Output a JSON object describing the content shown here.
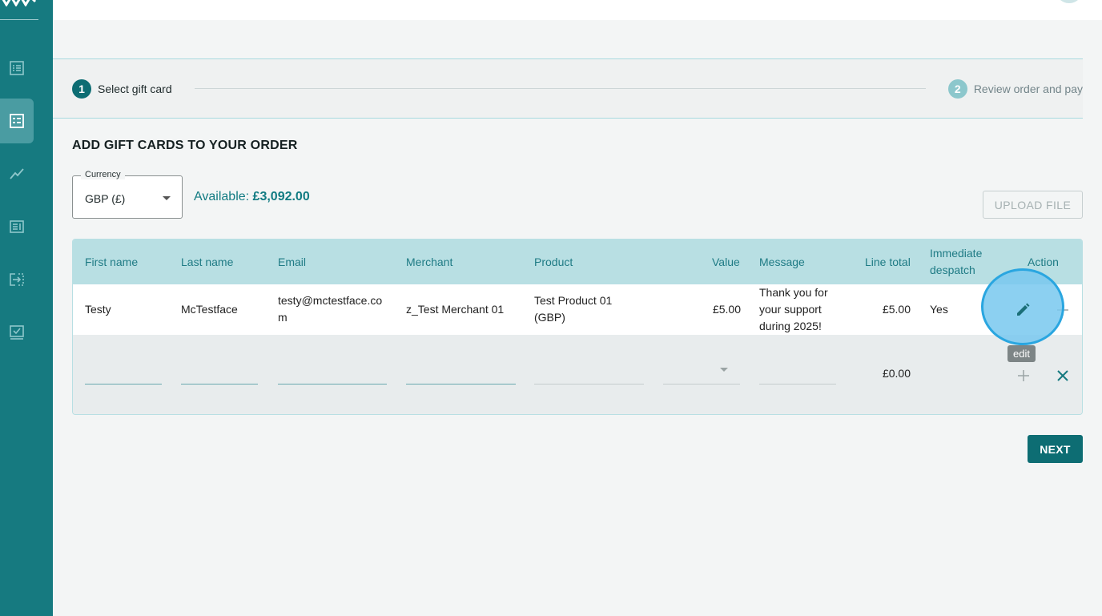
{
  "stepper": {
    "steps": [
      {
        "number": "1",
        "label": "Select gift card"
      },
      {
        "number": "2",
        "label": "Review order and pay"
      }
    ]
  },
  "page": {
    "heading": "ADD GIFT CARDS TO YOUR ORDER"
  },
  "currency": {
    "label": "Currency",
    "value": "GBP (£)"
  },
  "available": {
    "label": "Available:",
    "amount": "£3,092.00"
  },
  "upload_button": "UPLOAD FILE",
  "table": {
    "columns": [
      "First name",
      "Last name",
      "Email",
      "Merchant",
      "Product",
      "Value",
      "Message",
      "Line total",
      "Immediate despatch",
      "Action"
    ],
    "rows": [
      {
        "first_name": "Testy",
        "last_name": "McTestface",
        "email": "testy@mctestface.com",
        "merchant": "z_Test Merchant 01",
        "product": "Test Product 01 (GBP)",
        "value": "£5.00",
        "message": "Thank you for your support during 2025!",
        "line_total": "£5.00",
        "immediate_despatch": "Yes"
      }
    ],
    "new_row": {
      "line_total": "£0.00"
    }
  },
  "tooltip": "edit",
  "next_button": "NEXT",
  "icons": {
    "sidebar": [
      "orders-list-icon",
      "gift-card-list-icon",
      "analytics-chart-icon",
      "reports-icon",
      "transfer-icon",
      "checklist-icon"
    ],
    "actions": [
      "edit-icon",
      "add-icon",
      "close-icon"
    ]
  },
  "colors": {
    "primary": "#0d6d73",
    "sidebar": "#167a80",
    "table_header": "#b8dfe3",
    "accent_text": "#117b82",
    "highlight": "#2aa6e0"
  }
}
